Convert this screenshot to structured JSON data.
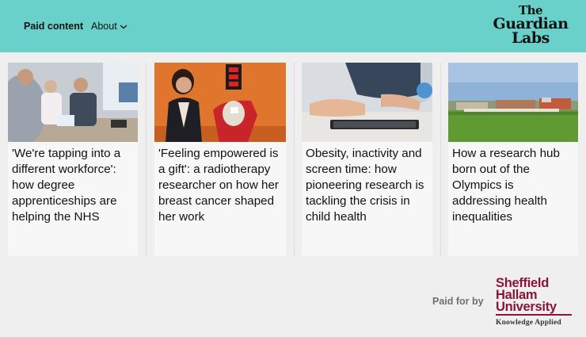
{
  "header": {
    "paid_content_label": "Paid content",
    "about_label": "About",
    "brand": {
      "line1": "The",
      "line2": "Guardian",
      "line3": "Labs"
    },
    "bg_color": "#69d1ca"
  },
  "cards": [
    {
      "title": "'We're tapping into a different workforce': how degree apprenticeships are helping the NHS",
      "image": "hospital-staff-photo"
    },
    {
      "title": "'Feeling empowered is a gift': a radiotherapy researcher on how her breast cancer shaped her work",
      "image": "researcher-with-radiotherapy-mannequin-photo"
    },
    {
      "title": "Obesity, inactivity and screen time: how pioneering research is tackling the crisis in child health",
      "image": "child-with-tablet-photo"
    },
    {
      "title": "How a research hub born out of the Olympics is addressing health inequalities",
      "image": "olympic-legacy-park-photo"
    }
  ],
  "footer": {
    "paid_for_by_label": "Paid for by",
    "sponsor": {
      "line1": "Sheffield",
      "line2": "Hallam",
      "line3": "University",
      "tagline": "Knowledge Applied",
      "color": "#8a1538"
    }
  }
}
